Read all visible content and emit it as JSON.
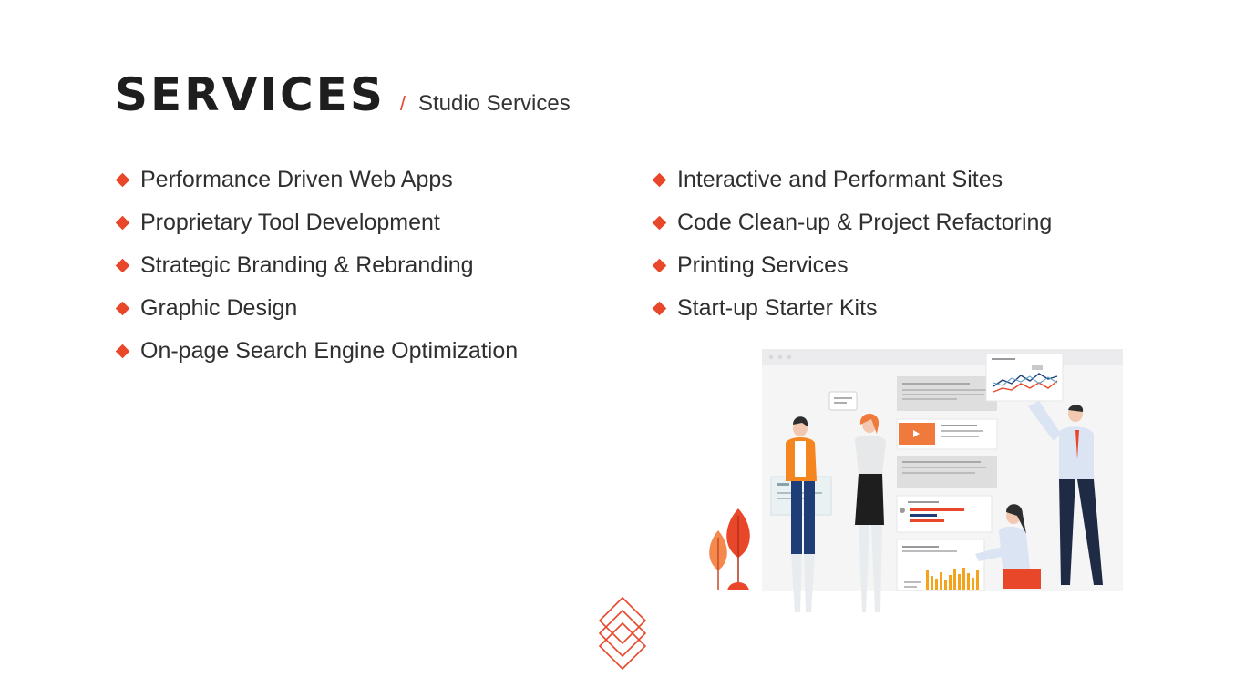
{
  "header": {
    "title": "SERVICES",
    "separator": "/",
    "subtitle": "Studio Services"
  },
  "services_left": [
    "Performance Driven Web Apps",
    "Proprietary Tool Development",
    "Strategic Branding & Rebranding",
    "Graphic Design",
    "On-page Search Engine Optimization"
  ],
  "services_right": [
    "Interactive and Performant Sites",
    "Code Clean-up & Project Refactoring",
    "Printing Services",
    "Start-up Starter Kits"
  ],
  "colors": {
    "accent": "#e8472a",
    "title": "#1e1e1e",
    "text": "#2f2f2f"
  },
  "icons": {
    "bullet": "diamond-bullet-icon",
    "logo": "stacked-diamonds-logo-icon"
  }
}
